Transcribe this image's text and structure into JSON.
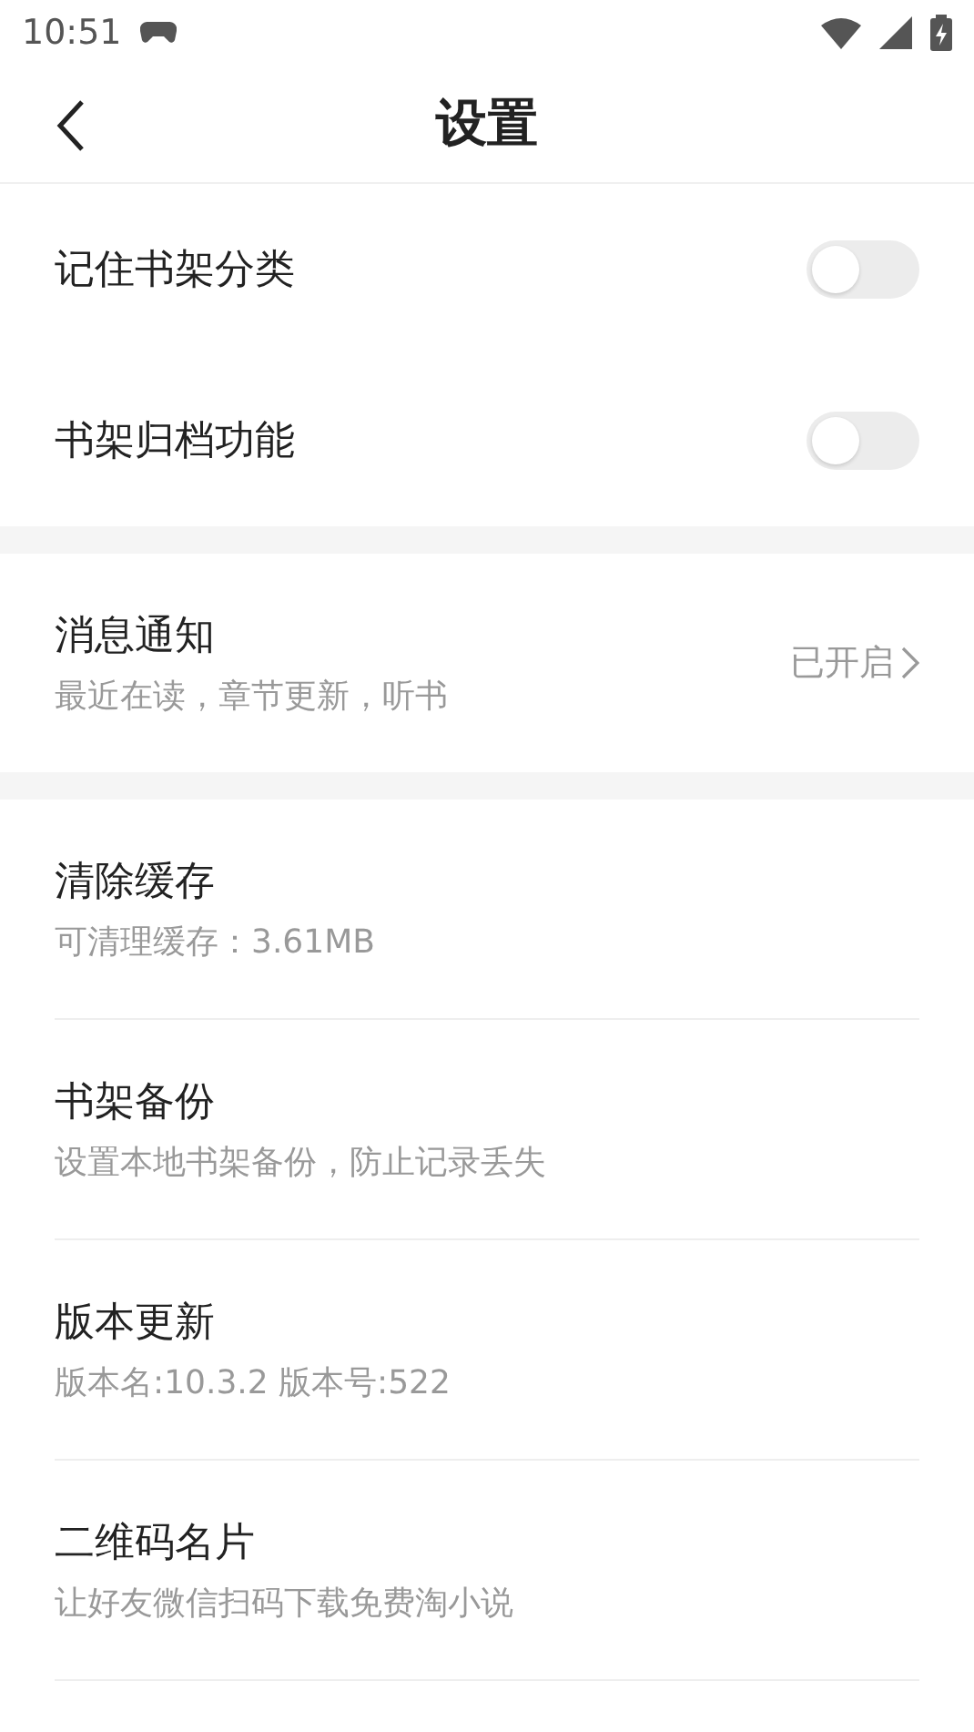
{
  "status_bar": {
    "time": "10:51"
  },
  "header": {
    "title": "设置"
  },
  "sections": [
    {
      "items": [
        {
          "kind": "toggle",
          "title": "记住书架分类",
          "on": false
        },
        {
          "kind": "toggle",
          "title": "书架归档功能",
          "on": false
        }
      ]
    },
    {
      "items": [
        {
          "kind": "link",
          "title": "消息通知",
          "subtitle": "最近在读，章节更新，听书",
          "value": "已开启"
        }
      ]
    },
    {
      "items": [
        {
          "kind": "info",
          "title": "清除缓存",
          "subtitle": "可清理缓存：3.61MB"
        },
        {
          "kind": "info",
          "title": "书架备份",
          "subtitle": "设置本地书架备份，防止记录丢失"
        },
        {
          "kind": "info",
          "title": "版本更新",
          "subtitle": "版本名:10.3.2  版本号:522"
        },
        {
          "kind": "info",
          "title": "二维码名片",
          "subtitle": "让好友微信扫码下载免费淘小说"
        }
      ]
    }
  ]
}
